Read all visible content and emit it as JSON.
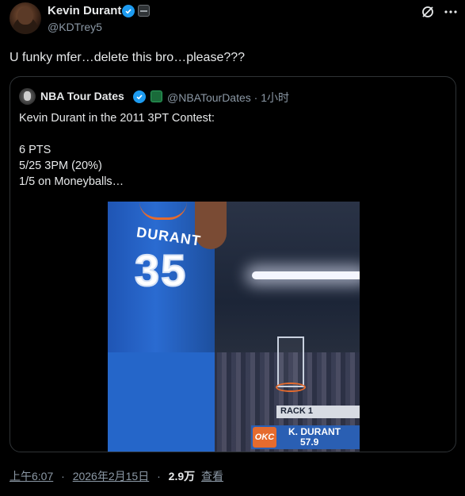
{
  "author": {
    "name": "Kevin Durant",
    "handle": "@KDTrey5"
  },
  "tweet": {
    "text": "U funky mfer…delete this bro…please???"
  },
  "quote": {
    "author_name": "NBA Tour Dates",
    "handle_time": "@NBATourDates · 1小时",
    "lines": [
      "Kevin Durant in the 2011 3PT Contest:",
      "",
      "6 PTS",
      "5/25 3PM (20%)",
      "1/5 on Moneyballs…"
    ]
  },
  "media": {
    "jersey_name": "DURANT",
    "jersey_number": "35",
    "rack_label": "RACK 1",
    "score_logo": "OKC",
    "score_name": "K. DURANT",
    "score_value": "57.9"
  },
  "footer": {
    "time": "上午6:07",
    "date": "2026年2月15日",
    "views_count": "2.9万",
    "views_label": "查看",
    "separator": "·"
  },
  "colors": {
    "verified": "#1d9bf0",
    "background": "#000000",
    "text": "#e7e9ea",
    "muted": "#8b98a5"
  }
}
